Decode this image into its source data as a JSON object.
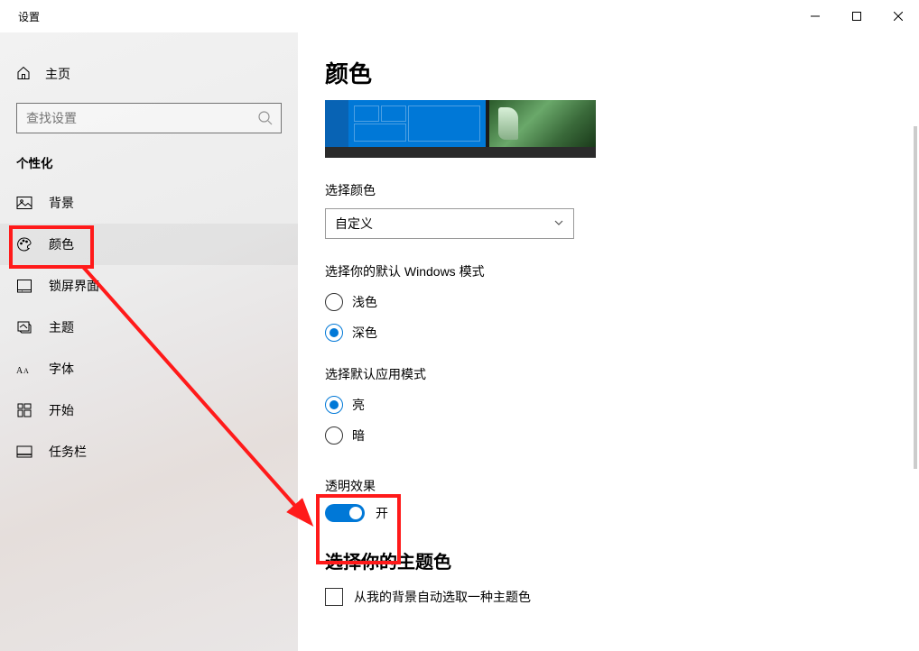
{
  "titlebar": {
    "title": "设置"
  },
  "sidebar": {
    "home": "主页",
    "search_placeholder": "查找设置",
    "section": "个性化",
    "items": [
      {
        "key": "background",
        "label": "背景"
      },
      {
        "key": "colors",
        "label": "颜色",
        "selected": true
      },
      {
        "key": "lockscreen",
        "label": "锁屏界面"
      },
      {
        "key": "themes",
        "label": "主题"
      },
      {
        "key": "fonts",
        "label": "字体"
      },
      {
        "key": "start",
        "label": "开始"
      },
      {
        "key": "taskbar",
        "label": "任务栏"
      }
    ]
  },
  "content": {
    "page_title": "颜色",
    "choose_color_label": "选择颜色",
    "color_mode_value": "自定义",
    "win_mode_label": "选择你的默认 Windows 模式",
    "win_mode_options": {
      "light": "浅色",
      "dark": "深色",
      "selected": "dark"
    },
    "app_mode_label": "选择默认应用模式",
    "app_mode_options": {
      "light": "亮",
      "dark": "暗",
      "selected": "light"
    },
    "transparency_label": "透明效果",
    "transparency_state": "开",
    "transparency_on": true,
    "accent_heading": "选择你的主题色",
    "auto_accent_label": "从我的背景自动选取一种主题色",
    "auto_accent_checked": false
  },
  "annotations": {
    "highlight1": "sidebar-colors",
    "highlight2": "transparency-toggle"
  }
}
